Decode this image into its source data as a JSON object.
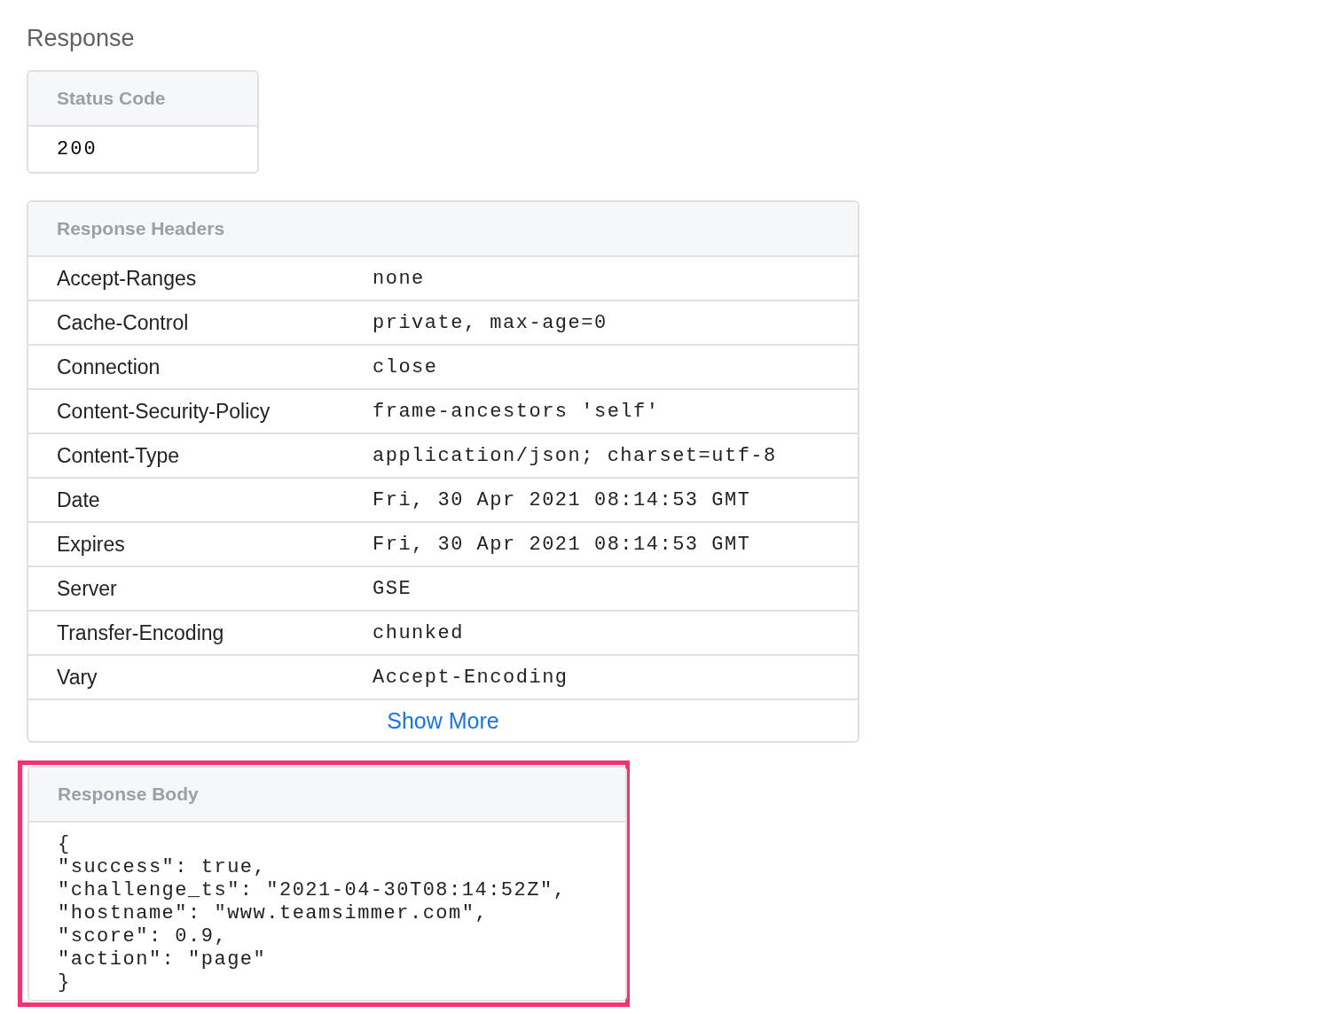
{
  "title": "Response",
  "status_code": {
    "heading": "Status Code",
    "value": "200"
  },
  "response_headers": {
    "heading": "Response Headers",
    "rows": [
      {
        "name": "Accept-Ranges",
        "value": "none"
      },
      {
        "name": "Cache-Control",
        "value": "private, max-age=0"
      },
      {
        "name": "Connection",
        "value": "close"
      },
      {
        "name": "Content-Security-Policy",
        "value": "frame-ancestors 'self'"
      },
      {
        "name": "Content-Type",
        "value": "application/json; charset=utf-8"
      },
      {
        "name": "Date",
        "value": "Fri, 30 Apr 2021 08:14:53 GMT"
      },
      {
        "name": "Expires",
        "value": "Fri, 30 Apr 2021 08:14:53 GMT"
      },
      {
        "name": "Server",
        "value": "GSE"
      },
      {
        "name": "Transfer-Encoding",
        "value": "chunked"
      },
      {
        "name": "Vary",
        "value": "Accept-Encoding"
      }
    ],
    "show_more": "Show More"
  },
  "response_body": {
    "heading": "Response Body",
    "highlighted": true,
    "lines": [
      "{",
      "\"success\": true,",
      "\"challenge_ts\": \"2021-04-30T08:14:52Z\",",
      "\"hostname\": \"www.teamsimmer.com\",",
      "\"score\": 0.9,",
      "\"action\": \"page\"",
      "}"
    ]
  }
}
